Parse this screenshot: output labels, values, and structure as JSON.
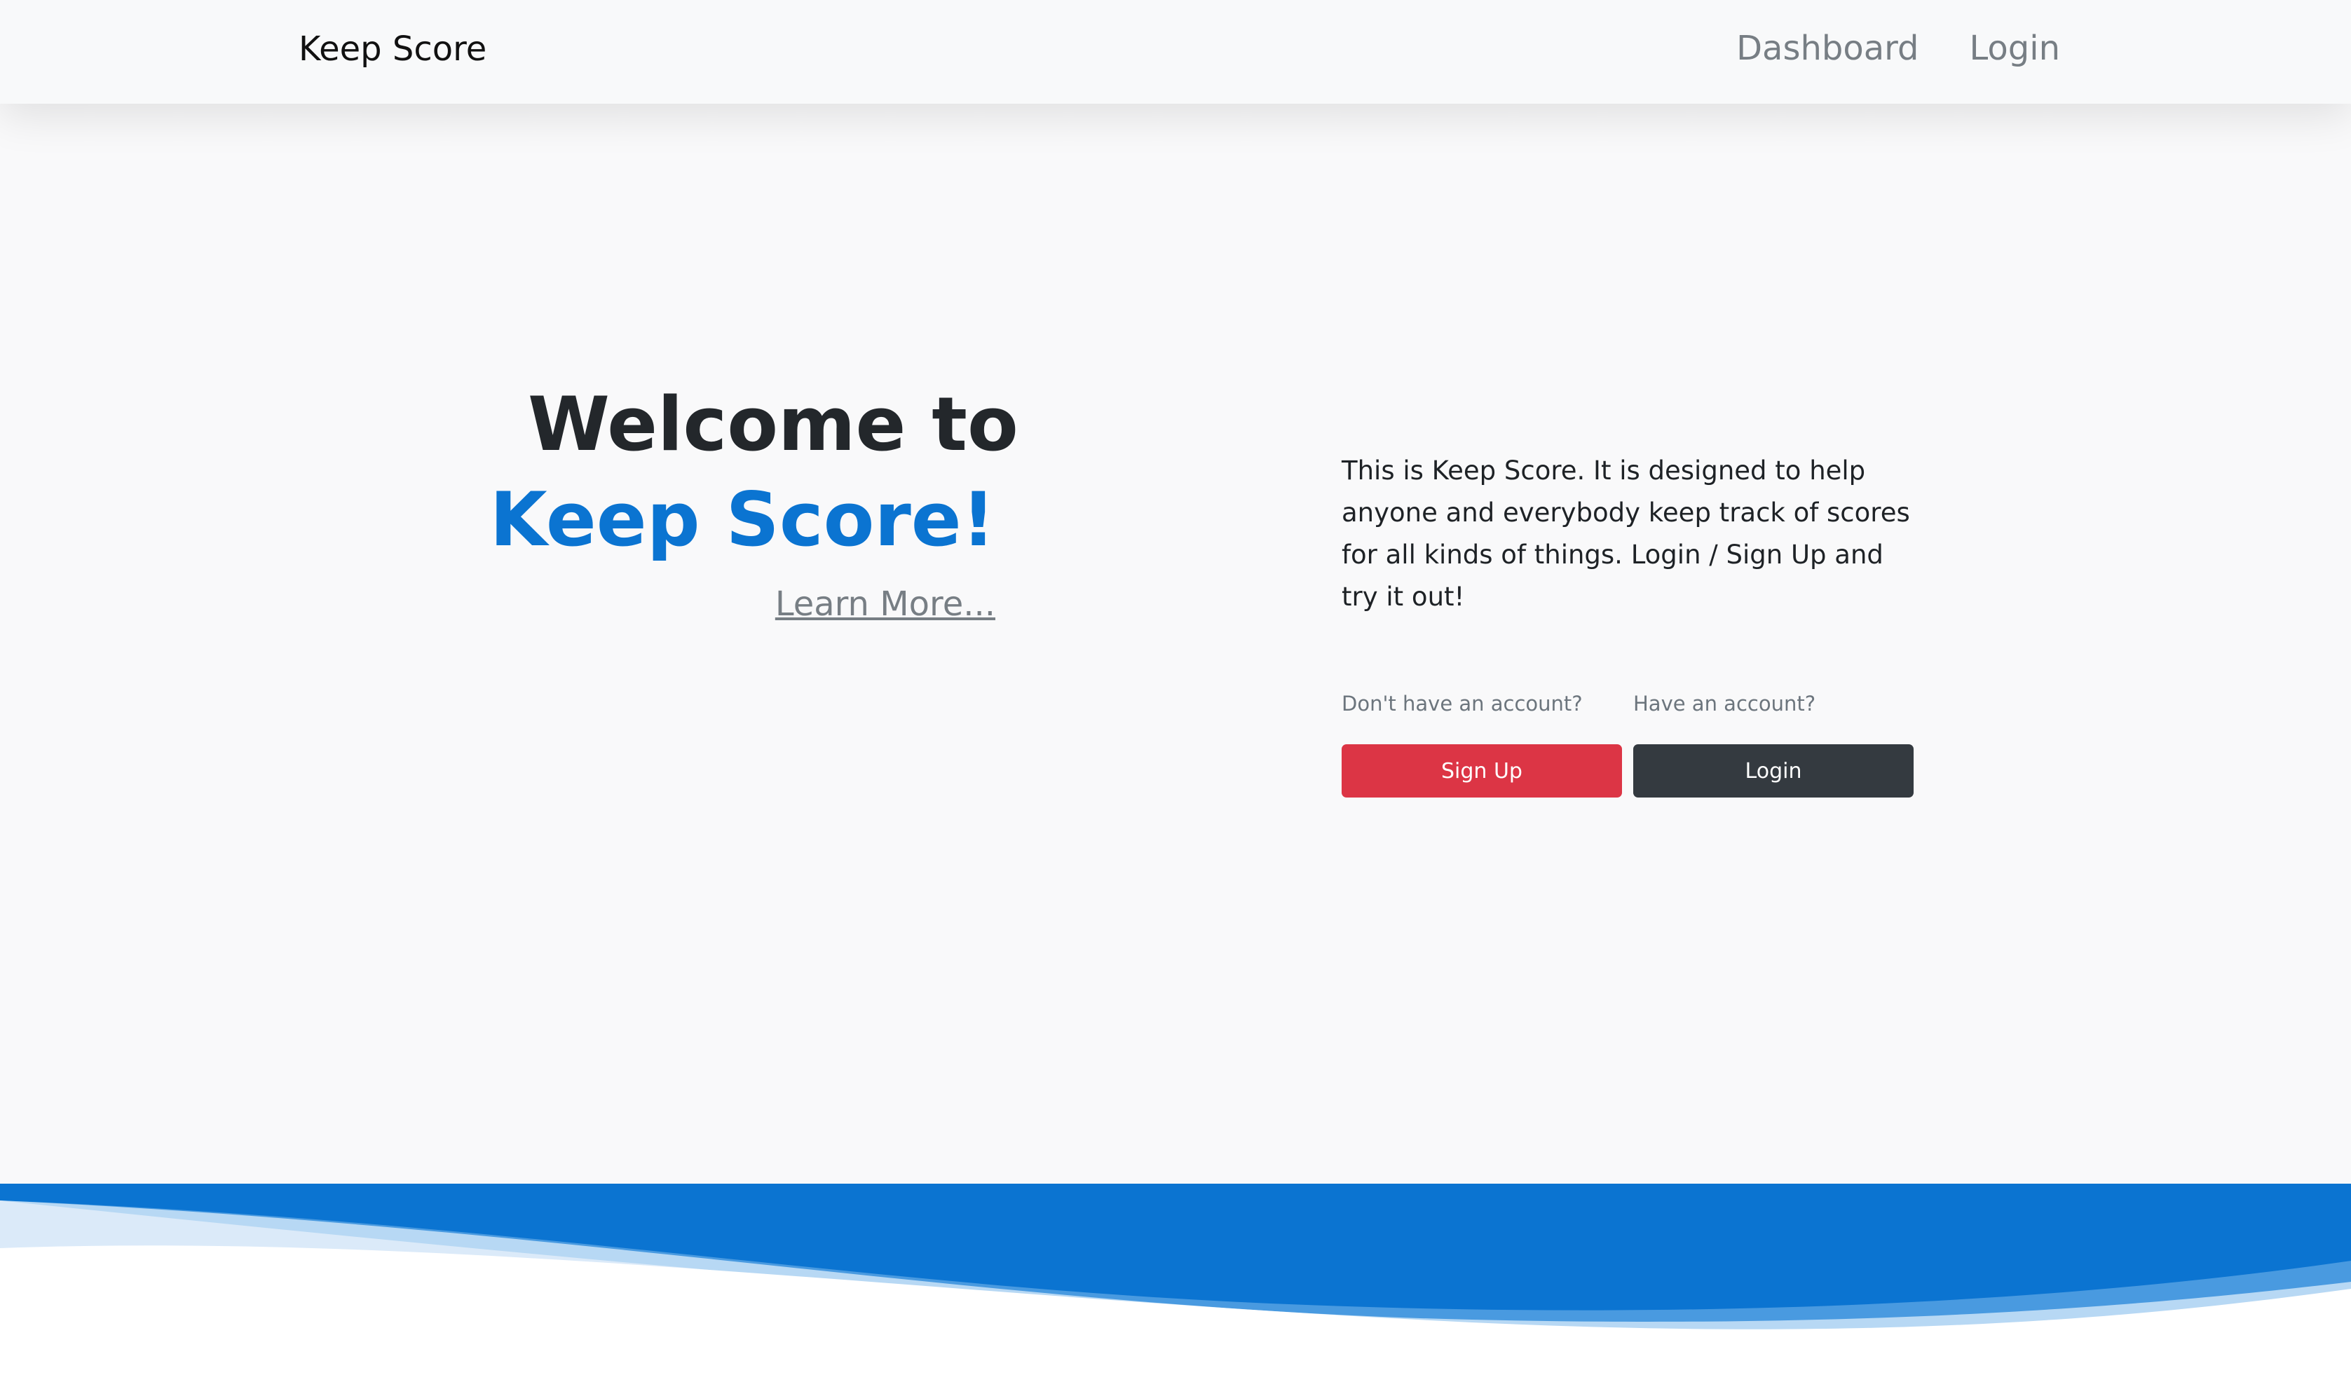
{
  "navbar": {
    "brand": "Keep Score",
    "links": [
      "Dashboard",
      "Login"
    ]
  },
  "hero": {
    "welcome": "Welcome to",
    "app_name": "Keep Score!",
    "learn_more": "Learn More..."
  },
  "intro": {
    "description": "This is Keep Score. It is designed to help anyone and everybody keep track of scores for all kinds of things. Login / Sign Up and try it out!",
    "signup_prompt": "Don't have an account?",
    "signup_label": "Sign Up",
    "login_prompt": "Have an account?",
    "login_label": "Login"
  },
  "colors": {
    "primary": "#0b74d1",
    "signup_button": "#dc3545",
    "login_button": "#343a40",
    "text_dark": "#23272b",
    "text_muted": "#777e84"
  }
}
